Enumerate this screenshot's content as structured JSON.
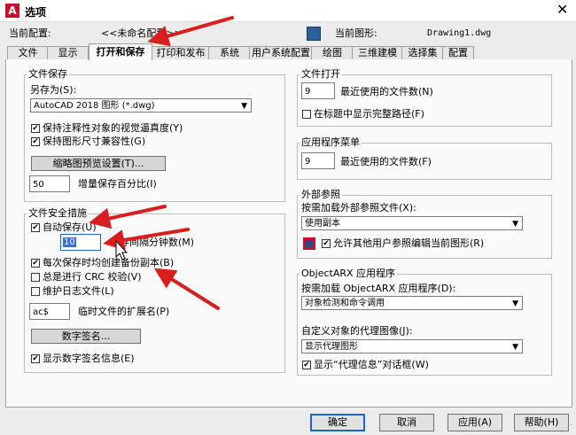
{
  "window": {
    "title": "选项",
    "app_icon": "A",
    "close": "✕"
  },
  "profile_bar": {
    "current_profile_label": "当前配置:",
    "current_profile_value": "<<未命名配置>>",
    "current_drawing_label": "当前图形:",
    "current_drawing_value": "Drawing1.dwg"
  },
  "tabs": [
    {
      "label": "文件"
    },
    {
      "label": "显示"
    },
    {
      "label": "打开和保存"
    },
    {
      "label": "打印和发布"
    },
    {
      "label": "系统"
    },
    {
      "label": "用户系统配置"
    },
    {
      "label": "绘图"
    },
    {
      "label": "三维建模"
    },
    {
      "label": "选择集"
    },
    {
      "label": "配置"
    }
  ],
  "file_save": {
    "group_title": "文件保存",
    "save_as_label": "另存为(S):",
    "save_as_value": "AutoCAD 2018 图形 (*.dwg)",
    "maintain_annotative": {
      "label": "保持注释性对象的视觉逼真度(Y)",
      "checked": true
    },
    "maintain_size_compat": {
      "label": "保持图形尺寸兼容性(G)",
      "checked": true
    },
    "thumbnail_button": "缩略图预览设置(T)...",
    "incremental_value": "50",
    "incremental_label": "增量保存百分比(I)"
  },
  "file_safety": {
    "group_title": "文件安全措施",
    "autosave": {
      "label": "自动保存(U)",
      "checked": true
    },
    "autosave_minutes_value": "10",
    "autosave_minutes_label": "保存间隔分钟数(M)",
    "backup_copy": {
      "label": "每次保存时均创建备份副本(B)",
      "checked": true
    },
    "crc_check": {
      "label": "总是进行 CRC 校验(V)",
      "checked": false
    },
    "log_file": {
      "label": "维护日志文件(L)",
      "checked": false
    },
    "temp_ext_value": "ac$",
    "temp_ext_label": "临时文件的扩展名(P)",
    "digital_sig_button": "数字签名...",
    "show_digital_sig": {
      "label": "显示数字签名信息(E)",
      "checked": true
    }
  },
  "file_open": {
    "group_title": "文件打开",
    "recent_value": "9",
    "recent_label": "最近使用的文件数(N)",
    "full_path": {
      "label": "在标题中显示完整路径(F)",
      "checked": false
    }
  },
  "app_menu": {
    "group_title": "应用程序菜单",
    "recent_value": "9",
    "recent_label": "最近使用的文件数(F)"
  },
  "xref": {
    "group_title": "外部参照",
    "demand_load_label": "按需加载外部参照文件(X):",
    "demand_load_value": "使用副本",
    "allow_edit": {
      "label": "允许其他用户参照编辑当前图形(R)",
      "checked": true
    }
  },
  "objectarx": {
    "group_title": "ObjectARX 应用程序",
    "demand_load_label": "按需加载 ObjectARX 应用程序(D):",
    "demand_load_value": "对象检测和命令调用",
    "proxy_label": "自定义对象的代理图像(J):",
    "proxy_value": "显示代理图形",
    "show_proxy_dialog": {
      "label": "显示“代理信息”对话框(W)",
      "checked": true
    }
  },
  "footer": {
    "ok": "确定",
    "cancel": "取消",
    "apply": "应用(A)",
    "help": "帮助(H)"
  },
  "colors": {
    "accent": "#1e64c8",
    "annotation_arrow": "#d81e1e"
  }
}
